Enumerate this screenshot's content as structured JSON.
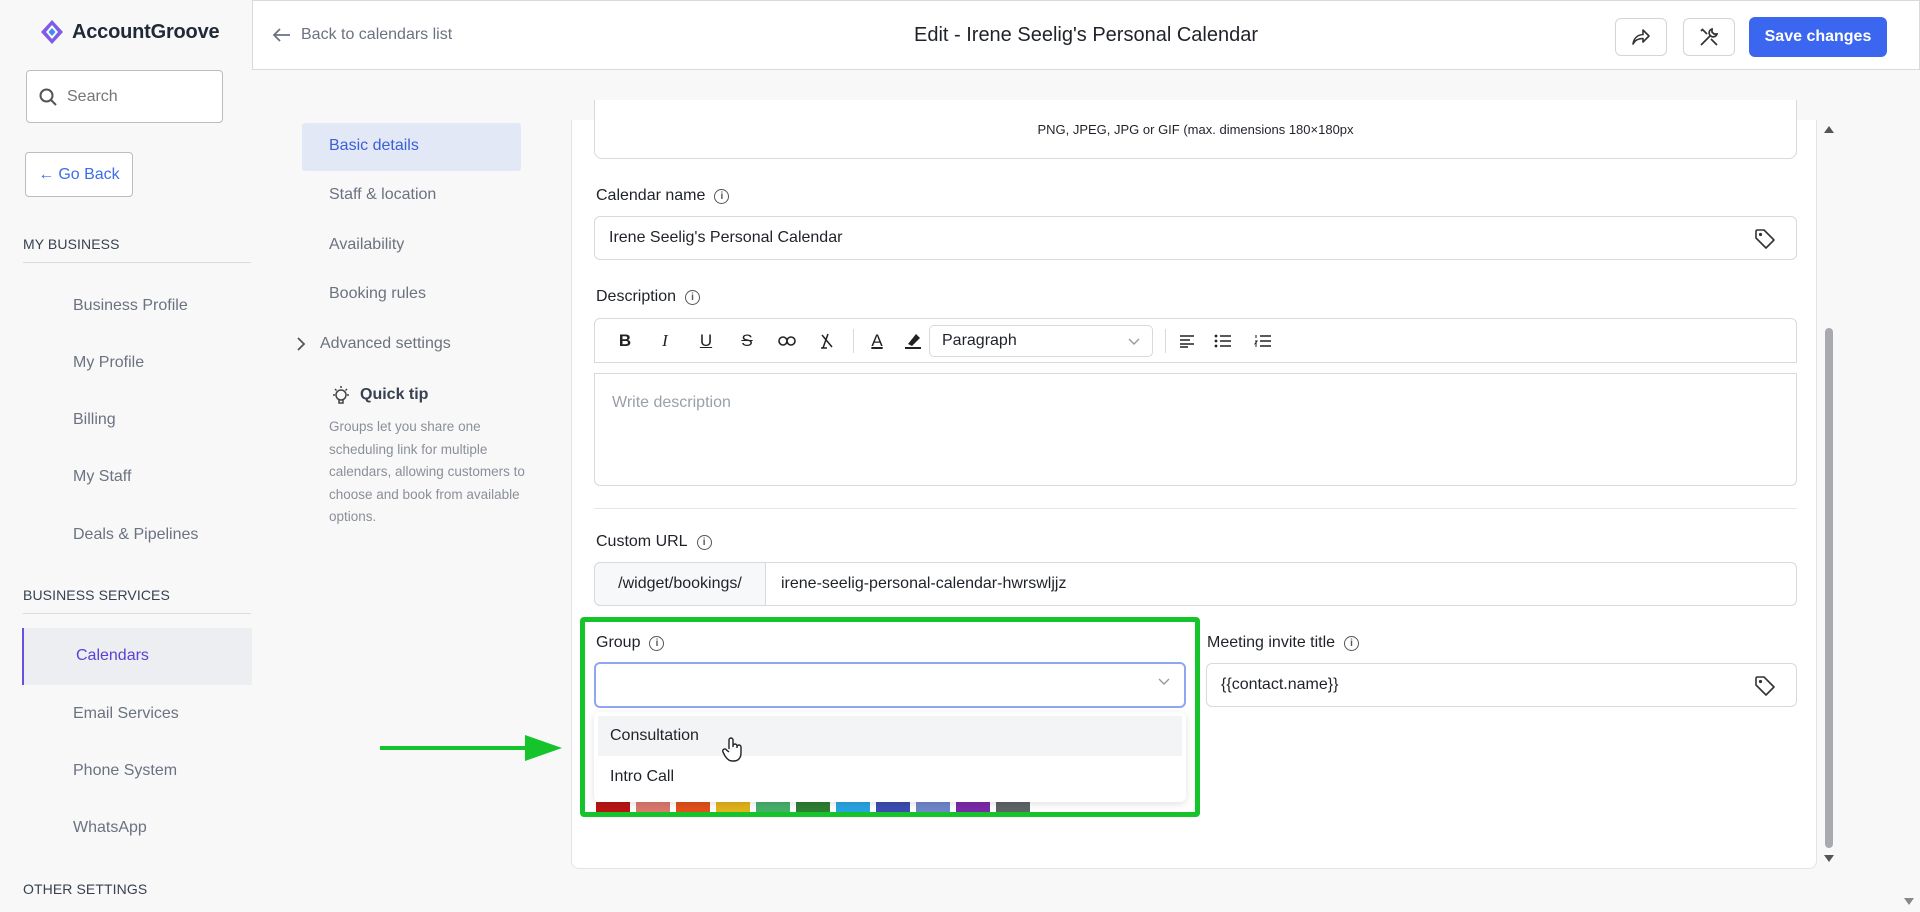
{
  "app": {
    "name": "AccountGroove"
  },
  "sidebar": {
    "search_placeholder": "Search",
    "go_back": "Go Back",
    "sections": [
      {
        "title": "MY BUSINESS",
        "items": [
          "Business Profile",
          "My Profile",
          "Billing",
          "My Staff",
          "Deals & Pipelines"
        ]
      },
      {
        "title": "BUSINESS SERVICES",
        "items": [
          "Calendars",
          "Email Services",
          "Phone System",
          "WhatsApp"
        ]
      },
      {
        "title": "OTHER SETTINGS",
        "items": []
      }
    ],
    "active_item": "Calendars"
  },
  "header": {
    "back_link": "Back to calendars list",
    "title": "Edit - Irene Seelig's Personal Calendar",
    "save_label": "Save changes"
  },
  "subnav": {
    "items": [
      "Basic details",
      "Staff & location",
      "Availability",
      "Booking rules"
    ],
    "active": "Basic details",
    "advanced": "Advanced settings",
    "tip_title": "Quick tip",
    "tip_body": "Groups let you share one scheduling link for multiple calendars, allowing customers to choose and book from available options."
  },
  "form": {
    "image_hint": "PNG, JPEG, JPG or GIF (max. dimensions 180×180px",
    "calendar_name_label": "Calendar name",
    "calendar_name_value": "Irene Seelig's Personal Calendar",
    "description_label": "Description",
    "paragraph_select": "Paragraph",
    "description_placeholder": "Write description",
    "custom_url_label": "Custom URL",
    "url_prefix": "/widget/bookings/",
    "url_slug": "irene-seelig-personal-calendar-hwrswljjz",
    "group_label": "Group",
    "group_value": "",
    "group_options": [
      "Consultation",
      "Intro Call"
    ],
    "hovered_option": "Consultation",
    "meeting_title_label": "Meeting invite title",
    "meeting_title_value": "{{contact.name}}"
  },
  "colors": {
    "accent": "#3b66ef",
    "highlight": "#15c42a",
    "swatches": [
      "#b81414",
      "#d9786c",
      "#e0501b",
      "#e0b21b",
      "#46b06a",
      "#2e7d32",
      "#29a3e0",
      "#3b4bb0",
      "#6f86c9",
      "#7a2aa8",
      "#5d6466"
    ]
  }
}
